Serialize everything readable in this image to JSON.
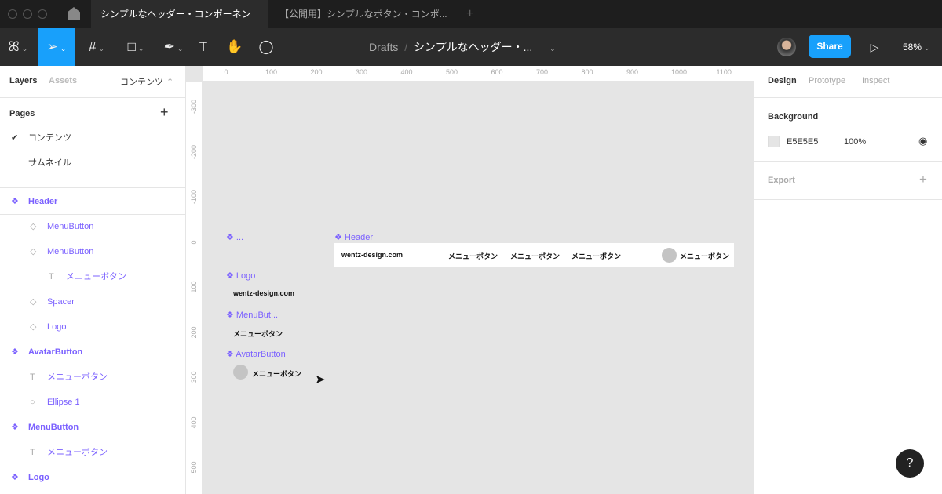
{
  "tabs": {
    "active": "シンプルなヘッダー・コンポーネント",
    "other": "【公開用】シンプルなボタン・コンポ...",
    "close": "×",
    "add": "+"
  },
  "toolbar": {
    "breadcrumb_root": "Drafts",
    "separator": "/",
    "file_name": "シンプルなヘッダー・...",
    "share": "Share",
    "zoom": "58%"
  },
  "left": {
    "tab_layers": "Layers",
    "tab_assets": "Assets",
    "page_selector": "コンテンツ",
    "pages_title": "Pages",
    "pages": [
      "コンテンツ",
      "サムネイル"
    ],
    "layers": [
      {
        "name": "Header",
        "type": "component",
        "indent": 0
      },
      {
        "name": "MenuButton",
        "type": "instance",
        "indent": 1
      },
      {
        "name": "MenuButton",
        "type": "instance",
        "indent": 1
      },
      {
        "name": "メニューボタン",
        "type": "text",
        "indent": 2
      },
      {
        "name": "Spacer",
        "type": "instance",
        "indent": 1
      },
      {
        "name": "Logo",
        "type": "instance",
        "indent": 1
      },
      {
        "name": "AvatarButton",
        "type": "component",
        "indent": 0
      },
      {
        "name": "メニューボタン",
        "type": "text",
        "indent": 1
      },
      {
        "name": "Ellipse 1",
        "type": "ellipse",
        "indent": 1
      },
      {
        "name": "MenuButton",
        "type": "component",
        "indent": 0
      },
      {
        "name": "メニューボタン",
        "type": "text",
        "indent": 1
      },
      {
        "name": "Logo",
        "type": "component",
        "indent": 0
      }
    ]
  },
  "right": {
    "tabs": [
      "Design",
      "Prototype",
      "Inspect"
    ],
    "background_title": "Background",
    "bg_color": "E5E5E5",
    "bg_opacity": "100%",
    "export_title": "Export",
    "add": "+"
  },
  "rulers": {
    "top": [
      "0",
      "100",
      "200",
      "300",
      "400",
      "500",
      "600",
      "700",
      "800",
      "900",
      "1000",
      "1100"
    ],
    "left": [
      "-300",
      "-200",
      "-100",
      "0",
      "100",
      "200",
      "300",
      "400",
      "500"
    ]
  },
  "canvas": {
    "frame_dots": "...",
    "header_label": "Header",
    "logo_label": "Logo",
    "menubutton_label": "MenuBut...",
    "avatar_label": "AvatarButton",
    "logo_text": "wentz-design.com",
    "menu_text": "メニューボタン"
  },
  "help": "?"
}
